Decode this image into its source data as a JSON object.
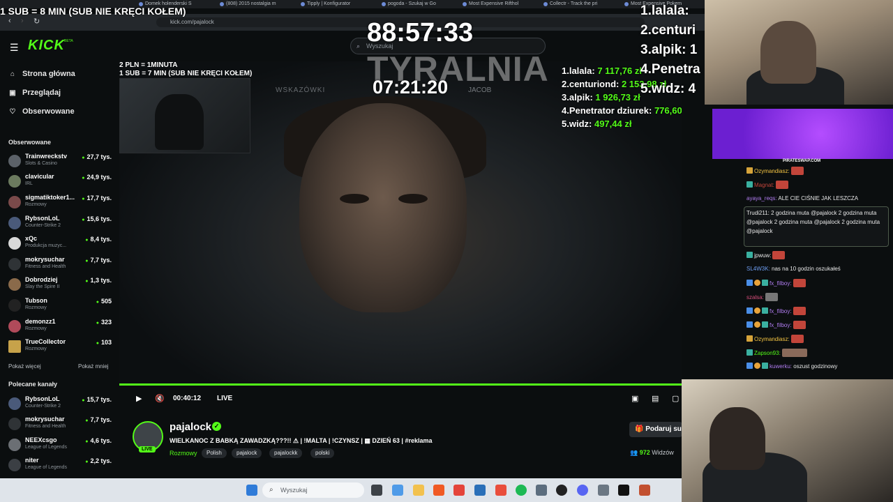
{
  "browser": {
    "tabs": [
      "Domek holenderski S",
      "(808) 2015 nostalgia m",
      "Tipply | Konfigurator",
      "pogoda - Szukaj w Go",
      "Most Expensive Rifthol",
      "Collectr - Track the pri",
      "Most Expensive Pokem"
    ],
    "url": "kick.com/pajalock"
  },
  "overlay": {
    "top_line": "1 SUB = 8 MIN (SUB NIE KRĘCI KOŁEM)",
    "timer_big": "88:57:33",
    "brand": "TYRALNIA",
    "timer_small": "07:21:20"
  },
  "header": {
    "logo": "KICK",
    "logo_badge": "BETA",
    "search_placeholder": "Wyszukaj"
  },
  "sidebar": {
    "nav": [
      {
        "label": "Strona główna",
        "icon": "home-icon"
      },
      {
        "label": "Przeglądaj",
        "icon": "browse-icon"
      },
      {
        "label": "Obserwowane",
        "icon": "heart-icon"
      }
    ],
    "followed_title": "Obserwowane",
    "followed": [
      {
        "name": "Trainwreckstv",
        "category": "Slots & Casino",
        "viewers": "27,7 tys."
      },
      {
        "name": "clavicular",
        "category": "IRL",
        "viewers": "24,9 tys."
      },
      {
        "name": "sigmatiktoker1...",
        "category": "Rozmowy",
        "viewers": "17,7 tys."
      },
      {
        "name": "RybsonLoL",
        "category": "Counter-Strike 2",
        "viewers": "15,6 tys."
      },
      {
        "name": "xQc",
        "category": "Produkcja muzyc...",
        "viewers": "8,4 tys."
      },
      {
        "name": "mokrysuchar",
        "category": "Fitness and Health",
        "viewers": "7,7 tys."
      },
      {
        "name": "Dobrodziej",
        "category": "Slay the Spire II",
        "viewers": "1,3 tys."
      },
      {
        "name": "Tubson",
        "category": "Rozmowy",
        "viewers": "505"
      },
      {
        "name": "demonzz1",
        "category": "Rozmowy",
        "viewers": "323"
      },
      {
        "name": "TrueCollector",
        "category": "Rozmowy",
        "viewers": "103"
      }
    ],
    "show_more": "Pokaż więcej",
    "show_less": "Pokaż mniej",
    "recommended_title": "Polecane kanały",
    "recommended": [
      {
        "name": "RybsonLoL",
        "category": "Counter-Strike 2",
        "viewers": "15,7 tys."
      },
      {
        "name": "mokrysuchar",
        "category": "Fitness and Health",
        "viewers": "7,7 tys."
      },
      {
        "name": "NEEXcsgo",
        "category": "League of Legends",
        "viewers": "4,6 tys."
      },
      {
        "name": "niter",
        "category": "League of Legends",
        "viewers": "2,2 tys."
      }
    ]
  },
  "video": {
    "rules_line1": "2 PLN = 1MINUTA",
    "rules_line2": "1 SUB = 7 MIN (SUB NIE KRĘCI KOŁEM)",
    "hint_left": "WSKAZÓWKI",
    "hint_right": "JACOB",
    "donors": [
      {
        "name": "1.lalala:",
        "amount": "7 117,76 zł"
      },
      {
        "name": "2.centuriond:",
        "amount": "2 153,98 zł"
      },
      {
        "name": "3.alpik:",
        "amount": "1 926,73 zł"
      },
      {
        "name": "4.Penetrator dziurek:",
        "amount": "776,60 zł"
      },
      {
        "name": "5.widz:",
        "amount": "497,44 zł"
      }
    ],
    "progress": 1.0
  },
  "controls": {
    "time": "00:40:12",
    "live": "LIVE"
  },
  "stream": {
    "streamer": "pajalock",
    "live_badge": "LIVE",
    "title": "WIELKANOC Z BABKĄ ZAWADZKĄ???!! ⚠ | !MALTA | !CZYNSZ | ▦ DZIEŃ 63 | #reklama",
    "category": "Rozmowy",
    "tags": [
      "Polish",
      "pajalock",
      "pajalockk",
      "polski"
    ],
    "support_label": "Podaruj su",
    "viewers_count": "972",
    "viewers_label": "Widzów"
  },
  "taskbar": {
    "search_placeholder": "Wyszukaj"
  },
  "right_overlay": {
    "ranks": [
      "1.lalala:",
      "2.centurі",
      "3.alpik: 1",
      "4.Penetra",
      "5.widz: 4"
    ],
    "banner_caption": "PIRATESWAP.COM"
  },
  "chat": {
    "messages": [
      {
        "user": "Ozymandiasz:",
        "text": "",
        "color": "#f5c542"
      },
      {
        "user": "Magnat:",
        "text": "",
        "color": "#c2453a"
      },
      {
        "user": "ayaya_reqs:",
        "text": "ALE CIE CIŚNIE JAK LESZCZA",
        "color": "#b07cf0"
      },
      {
        "user": "Trudi211:",
        "text": "2 godzina muta @pajalock 2 godzina muta @pajalock 2 godzina muta @pajalock 2 godzina muta @pajalock",
        "color": "#e8e8e8"
      },
      {
        "user": "jpwuw:",
        "text": "",
        "color": "#e8e8e8"
      },
      {
        "user": "SL4W3K:",
        "text": "nas na 10 godzin oszukałeś",
        "color": "#6e9df2"
      },
      {
        "user": "fx_filboy:",
        "text": "",
        "color": "#b07cf0"
      },
      {
        "user": "szalsa:",
        "text": "",
        "color": "#d94e7b"
      },
      {
        "user": "fx_filboy:",
        "text": "",
        "color": "#b07cf0"
      },
      {
        "user": "fx_filboy:",
        "text": "",
        "color": "#b07cf0"
      },
      {
        "user": "Ozymandiasz:",
        "text": "",
        "color": "#f5c542"
      },
      {
        "user": "Zapson93:",
        "text": "",
        "color": "#53fc18"
      },
      {
        "user": "kuwerku:",
        "text": "oszust godzinowy",
        "color": "#b07cf0"
      }
    ]
  },
  "colors": {
    "accent": "#53fc18",
    "background": "#0b0e0f"
  }
}
